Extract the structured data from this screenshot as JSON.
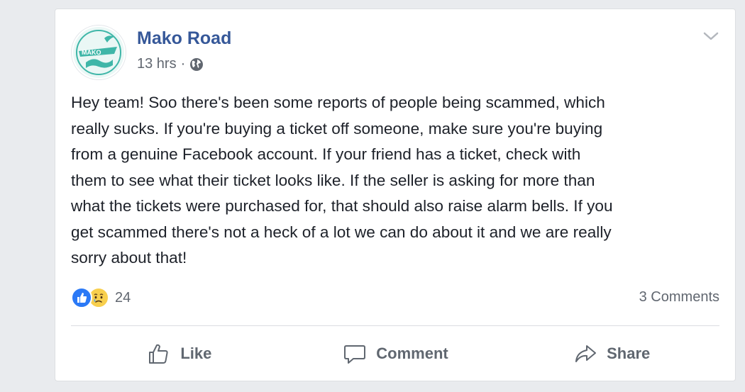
{
  "post": {
    "author": "Mako Road",
    "avatar_label": "MAKO",
    "timestamp": "13 hrs",
    "separator": "·",
    "privacy_icon": "globe-icon",
    "menu_icon": "chevron-down-icon",
    "message": "Hey team! Soo there's been some reports of people being scammed, which\nreally sucks. If you're buying a ticket off someone, make sure you're buying\nfrom a genuine Facebook account. If your friend has a ticket, check with\nthem to see what their ticket looks like. If the seller is asking for more than\nwhat the tickets were purchased for, that should also raise alarm bells. If you\nget scammed there's not a heck of a lot we can do about it and we are really\nsorry about that!"
  },
  "reactions": {
    "types": [
      "like-icon",
      "sad-icon"
    ],
    "count": "24"
  },
  "comments": {
    "label": "3 Comments"
  },
  "actions": {
    "like": "Like",
    "comment": "Comment",
    "share": "Share"
  },
  "colors": {
    "name_link": "#365899",
    "like_blue": "#2b79f6",
    "sad_yellow": "#f8cf4d",
    "avatar_teal": "#3fb6a8"
  }
}
